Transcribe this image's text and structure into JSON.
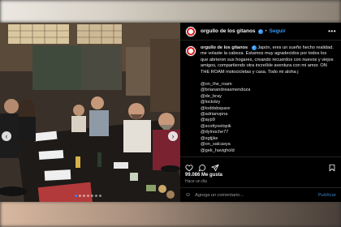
{
  "post": {
    "username": "orgullo de los gitanos",
    "follow_label": "Seguir",
    "more_label": "•••",
    "caption_lines": [
      "Japón, eres un sueño hecho realidad.",
      "me volaste la cabeza. Estamos muy agradecidos por todos los",
      "que abrieron sus hogares, creando recuerdos con nuevos y viejos",
      "amigos, compartiendo otra increíble aventura con mi amor. ON",
      "THE ROAM motocicletas y casa. Todo mi aloha j"
    ],
    "handles": [
      "@on_the_roam",
      "@brianandreasmendoza",
      "@de_bray",
      "@lockdzy",
      "@toddsbspare",
      "@adrianvpna",
      "@ayp9",
      "@scottyxelopik",
      "@dylnoche77",
      "@sgtjjke",
      "@on_salcasya",
      "@gek_havighold"
    ],
    "likes": "99.086 Me gusta",
    "time_ago": "Hace un día",
    "comment_placeholder": "Agrega un comentario...",
    "publish_label": "Publicar"
  },
  "icons": {
    "heart": "heart-icon",
    "comment": "comment-icon",
    "share": "share-icon",
    "save": "bookmark-icon",
    "emoji": "emoji-icon",
    "prev": "chevron-left-icon",
    "next": "chevron-right-icon"
  },
  "colors": {
    "accent": "#3897f0",
    "background": "#000000"
  }
}
